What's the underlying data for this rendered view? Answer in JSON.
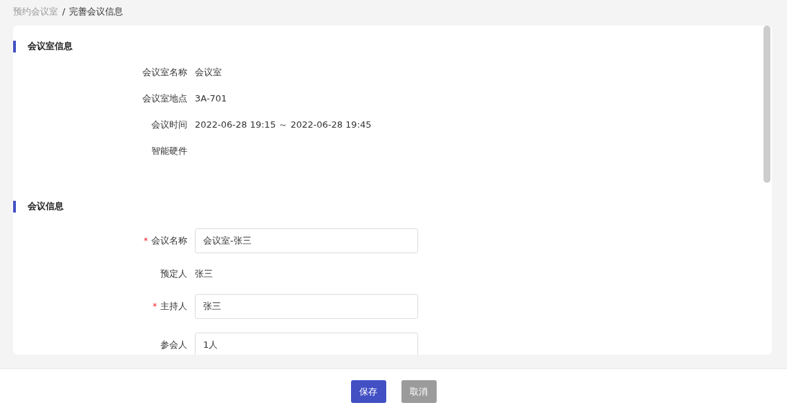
{
  "breadcrumb": [
    {
      "label": "预约会议室",
      "current": false
    },
    {
      "label": "完善会议信息",
      "current": true
    }
  ],
  "breadcrumb_separator": "/",
  "sections": [
    {
      "title": "会议室信息",
      "items": [
        {
          "kind": "text",
          "label": "会议室名称",
          "required": false,
          "value": "会议室"
        },
        {
          "kind": "text",
          "label": "会议室地点",
          "required": false,
          "value": "3A-701"
        },
        {
          "kind": "text",
          "label": "会议时间",
          "required": false,
          "value": "2022-06-28 19:15 ～ 2022-06-28 19:45"
        },
        {
          "kind": "text",
          "label": "智能硬件",
          "required": false
        }
      ]
    },
    {
      "title": "会议信息",
      "items": [
        {
          "kind": "input",
          "label": "会议名称",
          "required": true,
          "value": "会议室-张三"
        },
        {
          "kind": "text",
          "label": "预定人",
          "required": false,
          "value": "张三"
        },
        {
          "kind": "input",
          "label": "主持人",
          "required": true,
          "value": "张三"
        },
        {
          "kind": "input",
          "label": "参会人",
          "required": false,
          "value": "1人"
        }
      ]
    }
  ],
  "required_mark": "*",
  "buttons": [
    {
      "label": "保存",
      "kind": "primary"
    },
    {
      "label": "取消",
      "kind": "secondary"
    }
  ]
}
